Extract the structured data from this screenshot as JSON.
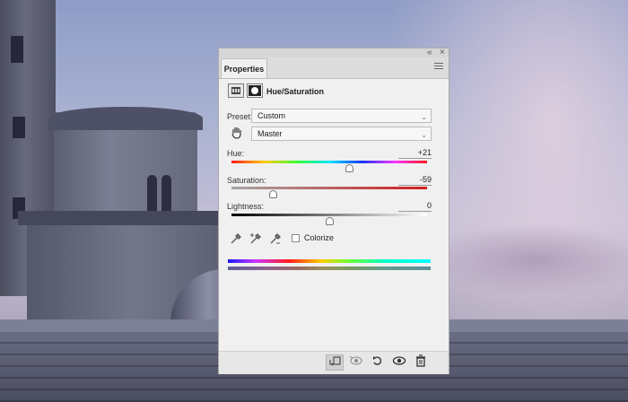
{
  "window": {
    "collapse_icon": "double-chevron-icon",
    "close_icon": "close-icon"
  },
  "panel": {
    "tab_label": "Properties",
    "adjustment_title": "Hue/Saturation",
    "preset_label": "Preset:",
    "preset_value": "Custom",
    "channel_value": "Master",
    "hue": {
      "label": "Hue:",
      "value": "+21",
      "level_fraction": 0.6
    },
    "saturation": {
      "label": "Saturation:",
      "value": "-59",
      "level_fraction": 0.21
    },
    "lightness": {
      "label": "Lightness:",
      "value": "0",
      "level_fraction": 0.5
    },
    "colorize_label": "Colorize",
    "colorize_checked": false
  },
  "bottom_toolbar": {
    "buttons": [
      "clip-to-layer-icon",
      "view-previous-state-icon",
      "reset-icon",
      "visibility-eye-icon",
      "trash-icon"
    ]
  },
  "colors": {
    "panel_bg": "#f0f0f0",
    "saturation_track": "#cc2a2a"
  }
}
